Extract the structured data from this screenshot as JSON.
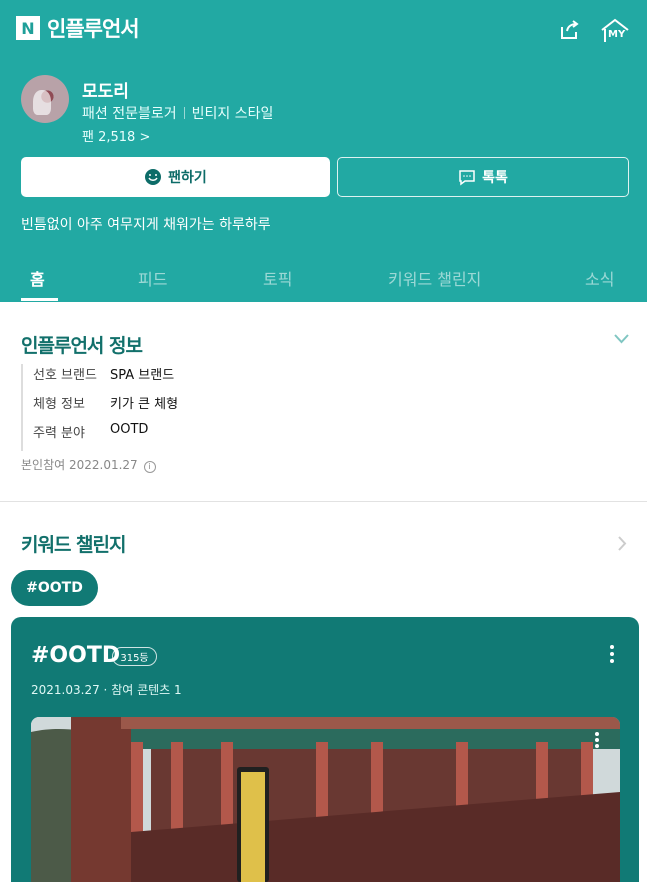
{
  "app": {
    "brand_logo": "N",
    "brand_name": "인플루언서",
    "my_label": "MY",
    "icons": [
      "share-icon",
      "home-my-icon",
      "smile-icon",
      "chat-icon",
      "chevron-down-icon",
      "chevron-right-icon",
      "info-icon",
      "more-icon"
    ]
  },
  "profile": {
    "name": "모도리",
    "category": "패션 전문블로거",
    "style": "빈티지 스타일",
    "fans": "팬 2,518 >"
  },
  "actions": {
    "fan": "팬하기",
    "talk": "톡톡"
  },
  "description": "빈틈없이 아주 여무지게 채워가는 하루하루",
  "tabs": [
    {
      "label": "홈",
      "active": true
    },
    {
      "label": "피드"
    },
    {
      "label": "토픽"
    },
    {
      "label": "키워드 챌린지"
    },
    {
      "label": "소식"
    }
  ],
  "info": {
    "title": "인플루언서 정보",
    "rows": [
      {
        "label": "선호 브랜드",
        "value": "SPA 브랜드"
      },
      {
        "label": "체형 정보",
        "value": "키가 큰 체형"
      },
      {
        "label": "주력 분야",
        "value": "OOTD"
      }
    ],
    "joined": "본인참여 2022.01.27",
    "info_icon": "i"
  },
  "challenge": {
    "title": "키워드 챌린지",
    "pill": "#OOTD",
    "card_title": "#OOTD",
    "rank": "315등",
    "date": "2021.03.27",
    "meta_separator": "·",
    "participation": "참여 콘텐츠 1"
  },
  "colors": {
    "teal": "#22a9a3",
    "dark_teal": "#117a75",
    "white": "#ffffff"
  }
}
